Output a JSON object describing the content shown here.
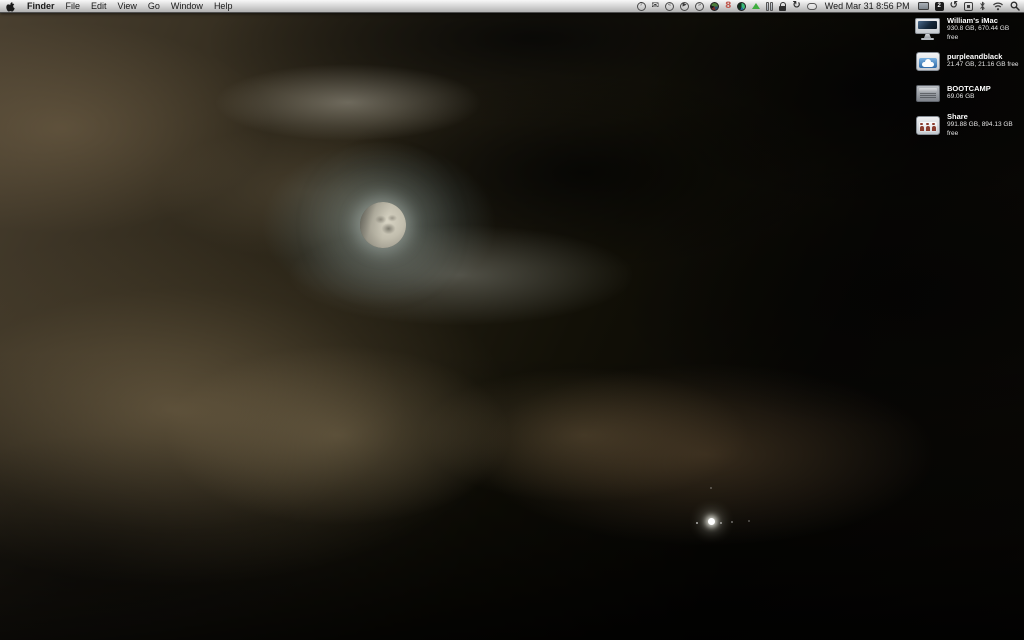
{
  "menu_bar": {
    "app_menu_label": "Finder",
    "menus": [
      "File",
      "Edit",
      "View",
      "Go",
      "Window",
      "Help"
    ],
    "clock_label": "Wed Mar 31 8:56 PM",
    "spaces_number": "2",
    "status_icons": [
      "help",
      "mail",
      "previous-track",
      "play",
      "next-track",
      "pinwheel",
      "activity-rings",
      "disk-usage-pie",
      "upload-arrow",
      "meter-bars",
      "keychain-lock",
      "sync",
      "ichat-bubble",
      "displays",
      "spaces",
      "time-machine",
      "screen-sharing",
      "bluetooth",
      "airport-wifi",
      "spotlight"
    ]
  },
  "desktop": {
    "volumes": [
      {
        "name": "William's iMac",
        "info": "930.8 GB, 670.44 GB free",
        "icon": "imac"
      },
      {
        "name": "purpleandblack",
        "info": "21.47 GB, 21.16 GB free",
        "icon": "external-drive-clouds"
      },
      {
        "name": "BOOTCAMP",
        "info": "69.06 GB",
        "icon": "internal-hard-drive"
      },
      {
        "name": "Share",
        "info": "991.88 GB, 894.13 GB free",
        "icon": "network-share-drive"
      }
    ],
    "wallpaper_features": [
      "moon-behind-clouds",
      "bright-star"
    ]
  },
  "colors": {
    "menu_bar_text": "#1a1a1a",
    "volume_label_text": "#ffffff",
    "sky_warm": "#8a7a5e",
    "sky_dark": "#0b0906",
    "moon": "#c6c2b2",
    "star": "#ffffff"
  }
}
